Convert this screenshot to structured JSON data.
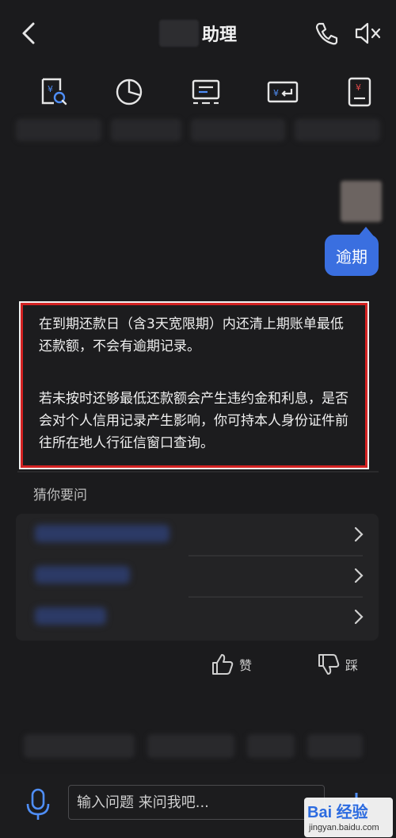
{
  "header": {
    "title": "助理",
    "back_icon": "chevron-left-icon",
    "call_icon": "phone-icon",
    "mute_icon": "speaker-mute-icon"
  },
  "toolbar": {
    "icons": [
      "bill-search-icon",
      "pie-chart-icon",
      "monitor-icon",
      "transfer-icon",
      "payment-icon"
    ]
  },
  "chat": {
    "user_message": "逾期",
    "answer_paragraphs": [
      "在到期还款日（含3天宽限期）内还清上期账单最低还款额，不会有逾期记录。",
      "若未按时还够最低还款额会产生违约金和利息，是否会对个人信用记录产生影响，你可持本人身份证件前往所在地人行征信窗口查询。"
    ],
    "answer_highlight_color": "#d32222"
  },
  "suggestions": {
    "label": "猜你要问"
  },
  "feedback": {
    "like_label": "赞",
    "dislike_label": "踩"
  },
  "input": {
    "placeholder": "输入问题 来问我吧..."
  },
  "watermark": {
    "main": "Bai 经验",
    "sub": "jingyan.baidu.com"
  },
  "colors": {
    "accent": "#3a6fe0",
    "background": "#1b1b1d"
  }
}
